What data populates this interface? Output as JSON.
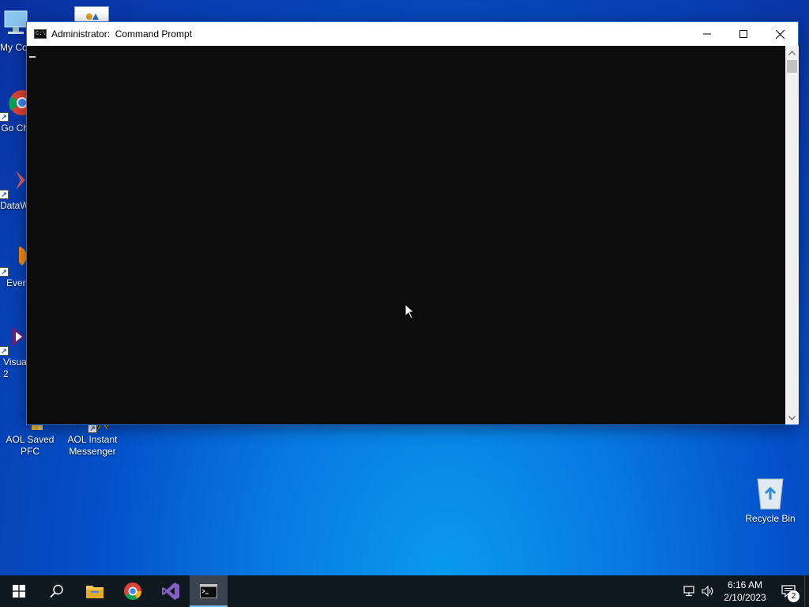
{
  "desktop": {
    "icons": [
      {
        "label": "My Co"
      },
      {
        "label": "Go Ch"
      },
      {
        "label": "DataW"
      },
      {
        "label": "Ever"
      },
      {
        "label": "Visua 2"
      },
      {
        "label": "AOL Saved PFC"
      },
      {
        "label": "AOL Instant Messenger"
      },
      {
        "label": "Recycle Bin"
      }
    ]
  },
  "window": {
    "title": "Administrator:  Command Prompt",
    "app_icon_text": "C:\\_",
    "console_text": ""
  },
  "taskbar": {
    "apps": [
      {
        "icon": "start-windows-icon"
      },
      {
        "icon": "search-icon"
      },
      {
        "icon": "file-explorer-icon"
      },
      {
        "icon": "chrome-icon"
      },
      {
        "icon": "visual-studio-icon"
      },
      {
        "icon": "command-prompt-icon",
        "active": true
      }
    ],
    "clock": {
      "time": "6:16 AM",
      "date": "2/10/2023"
    },
    "notification_count": "2"
  },
  "colors": {
    "console_bg": "#0c0c0c",
    "taskbar_bg": "#101820",
    "accent": "#76b9ed"
  }
}
